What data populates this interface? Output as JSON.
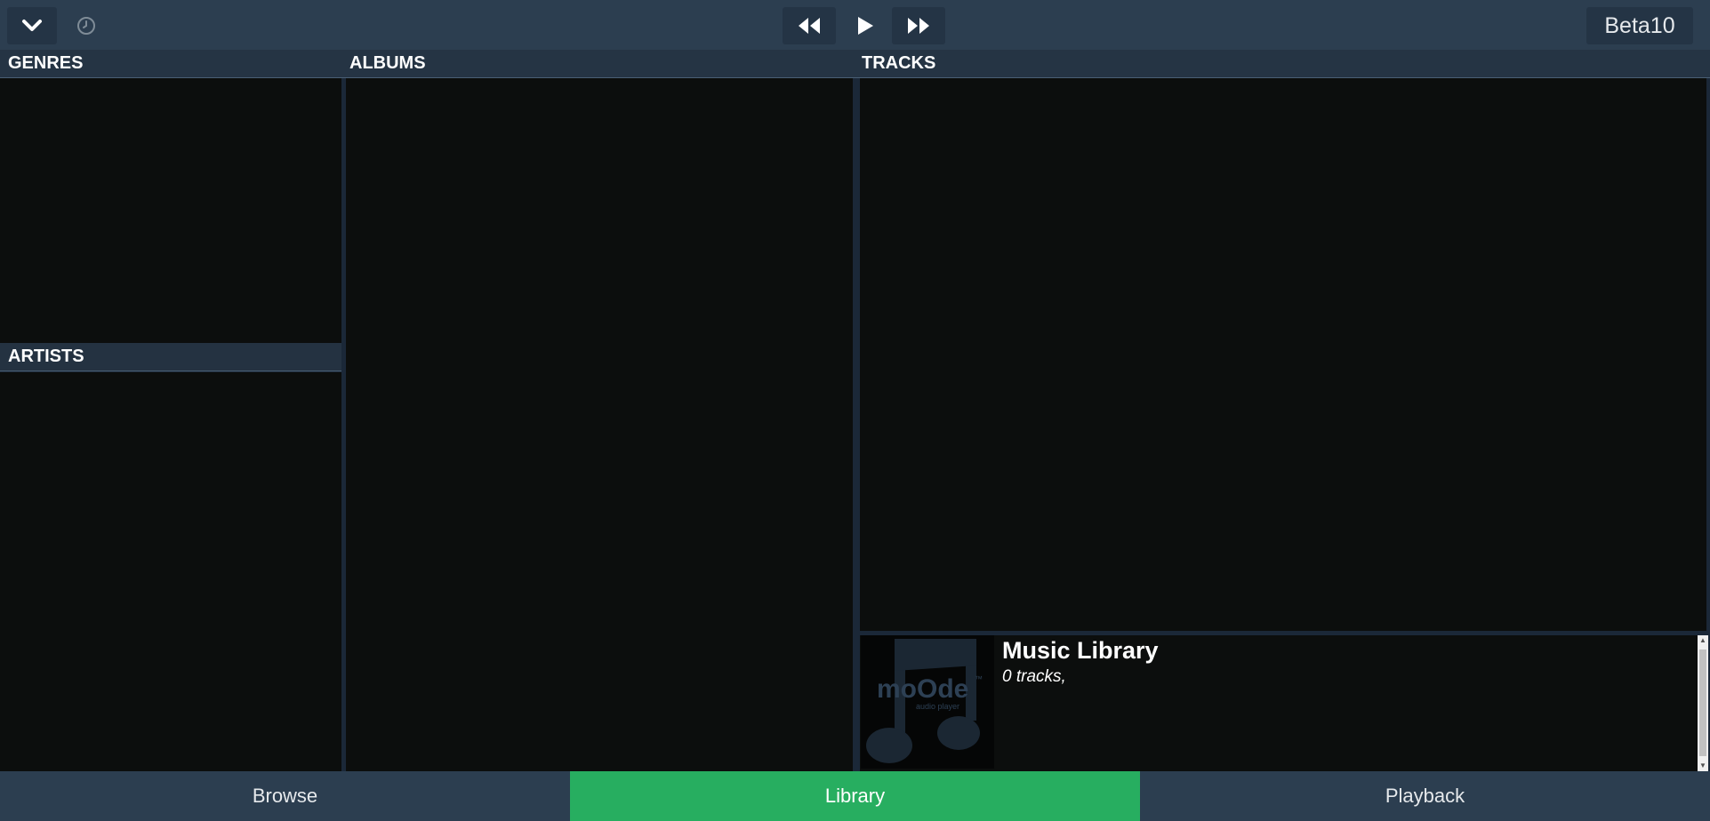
{
  "topbar": {
    "menu_icon": "chevron-down-icon",
    "clock_icon": "clock-icon",
    "prev_icon": "rewind-icon",
    "play_icon": "play-icon",
    "next_icon": "fast-forward-icon",
    "version_label": "Beta10"
  },
  "panels": {
    "genres_title": "GENRES",
    "artists_title": "ARTISTS",
    "albums_title": "ALBUMS",
    "tracks_title": "TRACKS"
  },
  "library": {
    "title": "Music Library",
    "count": "0 tracks,",
    "cover_logo": "moOde",
    "cover_tagline": "audio player",
    "cover_tm": "™"
  },
  "nav": {
    "tabs": [
      {
        "label": "Browse",
        "active": false
      },
      {
        "label": "Library",
        "active": true
      },
      {
        "label": "Playback",
        "active": false
      }
    ]
  },
  "colors": {
    "topbar": "#2c3e50",
    "panel_bg": "#0c0e0d",
    "accent_active": "#27ae60"
  }
}
